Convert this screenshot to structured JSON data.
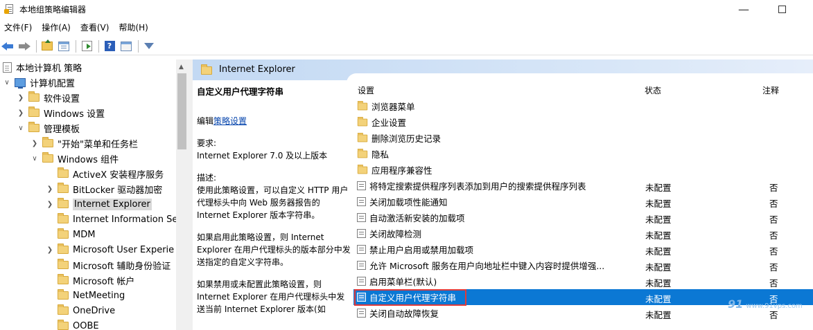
{
  "window": {
    "title": "本地组策略编辑器",
    "minimize_glyph": "—"
  },
  "menu": [
    "文件(F)",
    "操作(A)",
    "查看(V)",
    "帮助(H)"
  ],
  "toolbar": {
    "icons": [
      "back-arrow-icon",
      "forward-arrow-icon",
      "up-folder-icon",
      "show-tree-icon",
      "export-list-icon",
      "help-icon",
      "properties-icon",
      "filter-icon"
    ],
    "help_glyph": "?"
  },
  "tree": {
    "root": "本地计算机 策略",
    "computer_config": "计算机配置",
    "software_settings": "软件设置",
    "windows_settings": "Windows 设置",
    "admin_templates": "管理模板",
    "start_menu": "\"开始\"菜单和任务栏",
    "windows_components": "Windows 组件",
    "components": [
      {
        "label": "ActiveX 安装程序服务",
        "expandable": false
      },
      {
        "label": "BitLocker 驱动器加密",
        "expandable": true
      },
      {
        "label": "Internet Explorer",
        "expandable": true,
        "selected": true
      },
      {
        "label": "Internet Information Se",
        "expandable": false
      },
      {
        "label": "MDM",
        "expandable": false
      },
      {
        "label": "Microsoft User Experie",
        "expandable": true
      },
      {
        "label": "Microsoft 辅助身份验证",
        "expandable": false
      },
      {
        "label": "Microsoft 帐户",
        "expandable": false
      },
      {
        "label": "NetMeeting",
        "expandable": false
      },
      {
        "label": "OneDrive",
        "expandable": false
      },
      {
        "label": "OOBE",
        "expandable": false
      }
    ]
  },
  "right": {
    "header_title": "Internet Explorer",
    "description": {
      "title": "自定义用户代理字符串",
      "edit_prefix": "编辑",
      "edit_link": "策略设置",
      "req_label": "要求:",
      "req_text": "Internet Explorer 7.0 及以上版本",
      "desc_label": "描述:",
      "desc_text": "使用此策略设置，可以自定义 HTTP 用户代理标头中向 Web 服务器报告的 Internet Explorer 版本字符串。",
      "if_enabled": "如果启用此策略设置，则 Internet Explorer 在用户代理标头的版本部分中发送指定的自定义字符串。",
      "if_disabled": "如果禁用或未配置此策略设置，则 Internet Explorer 在用户代理标头中发送当前 Internet Explorer 版本(如"
    },
    "columns": {
      "setting": "设置",
      "state": "状态",
      "comment": "注释"
    },
    "folders": [
      "浏览器菜单",
      "企业设置",
      "删除浏览历史记录",
      "隐私",
      "应用程序兼容性"
    ],
    "policies": [
      {
        "name": "将特定搜索提供程序列表添加到用户的搜索提供程序列表",
        "state": "未配置",
        "comment": "否"
      },
      {
        "name": "关闭加载项性能通知",
        "state": "未配置",
        "comment": "否"
      },
      {
        "name": "自动激活新安装的加载项",
        "state": "未配置",
        "comment": "否"
      },
      {
        "name": "关闭故障检测",
        "state": "未配置",
        "comment": "否"
      },
      {
        "name": "禁止用户启用或禁用加载项",
        "state": "未配置",
        "comment": "否"
      },
      {
        "name": "允许 Microsoft 服务在用户向地址栏中键入内容时提供增强...",
        "state": "未配置",
        "comment": "否"
      },
      {
        "name": "启用菜单栏(默认)",
        "state": "未配置",
        "comment": "否"
      },
      {
        "name": "自定义用户代理字符串",
        "state": "未配置",
        "comment": "否",
        "selected": true
      },
      {
        "name": "关闭自动故障恢复",
        "state": "未配置",
        "comment": "否"
      }
    ],
    "watermark": {
      "logo": "91",
      "url": "www.91vps.com"
    }
  },
  "colors": {
    "selection": "#0b78d4",
    "highlight_box": "#e03a3a",
    "header_band": "#c3d9f3",
    "link": "#0645ad"
  }
}
